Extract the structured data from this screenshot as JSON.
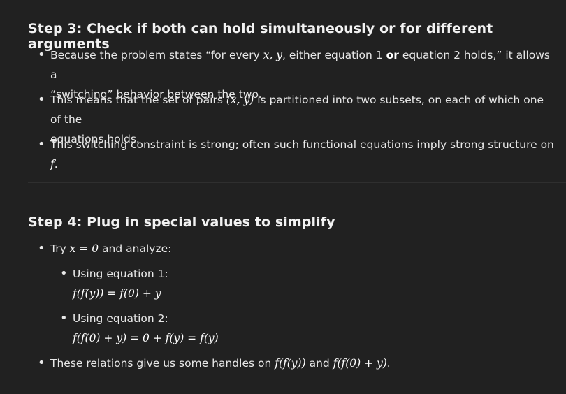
{
  "step3": {
    "heading": "Step 3: Check if both can hold simultaneously or for different arguments",
    "b1_part1": "Because the problem states “for every ",
    "b1_math1": "x, y",
    "b1_part2": ", either equation 1 ",
    "b1_bold": "or",
    "b1_part3": " equation 2 holds,” it allows a",
    "b1_line2": "“switching” behavior between the two.",
    "b2_part1": "This means that the set of pairs ",
    "b2_math": "(x, y)",
    "b2_part2": " is partitioned into two subsets, on each of which one of the",
    "b2_line2": "equations holds.",
    "b3_part1": "This switching constraint is strong; often such functional equations imply strong structure on ",
    "b3_math": "f",
    "b3_part2": "."
  },
  "step4": {
    "heading": "Step 4: Plug in special values to simplify",
    "b1_part1": "Try ",
    "b1_math": "x = 0",
    "b1_part2": " and analyze:",
    "sub1_label": "Using equation 1:",
    "sub1_eq": "f(f(y)) = f(0) + y",
    "sub2_label": "Using equation 2:",
    "sub2_eq": "f(f(0) + y) = 0 + f(y) = f(y)",
    "b2_part1": "These relations give us some handles on ",
    "b2_math1": "f(f(y))",
    "b2_mid": " and ",
    "b2_math2": "f(f(0) + y)",
    "b2_part2": "."
  }
}
